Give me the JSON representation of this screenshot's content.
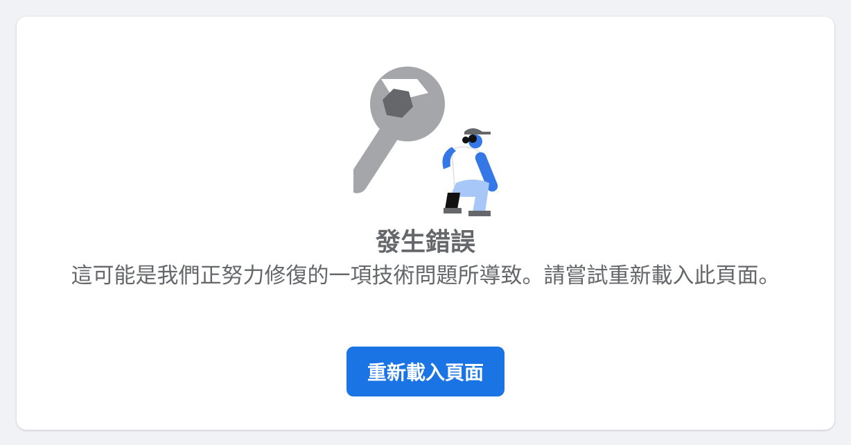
{
  "error": {
    "title": "發生錯誤",
    "message": "這可能是我們正努力修復的一項技術問題所導致。請嘗試重新載入此頁面。",
    "illustration_icon": "wrench-worker-illustration"
  },
  "actions": {
    "reload_label": "重新載入頁面"
  },
  "colors": {
    "background": "#f0f2f5",
    "card": "#ffffff",
    "text": "#65676b",
    "button": "#1b74e4",
    "button_text": "#ffffff"
  }
}
